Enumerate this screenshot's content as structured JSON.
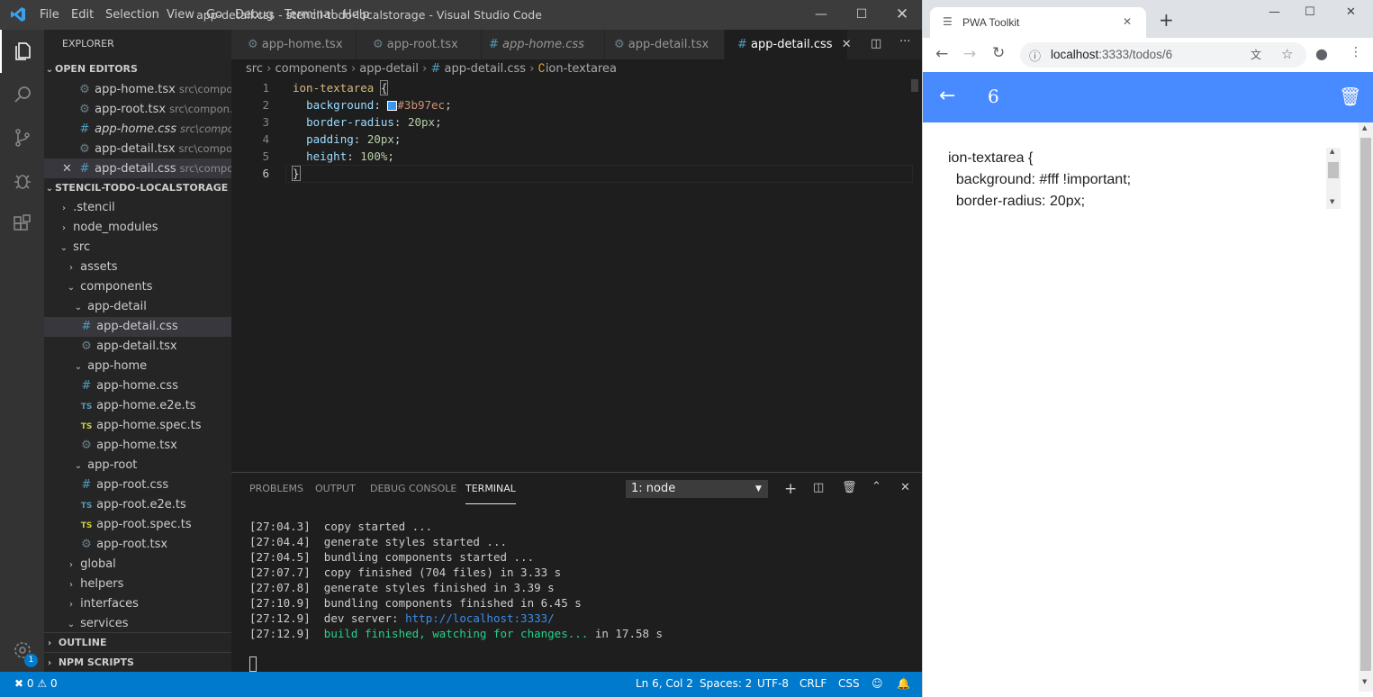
{
  "vscode": {
    "title": "app-detail.css - stencil-todo-localstorage - Visual Studio Code",
    "menu": [
      "File",
      "Edit",
      "Selection",
      "View",
      "Go",
      "Debug",
      "Terminal",
      "Help"
    ],
    "activity_badge": "1",
    "explorer": {
      "title": "EXPLORER",
      "open_editors_header": "OPEN EDITORS",
      "open_editors": [
        {
          "name": "app-home.tsx",
          "path": "src\\compo...",
          "icon": "gear-icon"
        },
        {
          "name": "app-root.tsx",
          "path": "src\\compon...",
          "icon": "gear-icon"
        },
        {
          "name": "app-home.css",
          "path": "src\\compon...",
          "icon": "hash-icon"
        },
        {
          "name": "app-detail.tsx",
          "path": "src\\compo...",
          "icon": "gear-icon"
        },
        {
          "name": "app-detail.css",
          "path": "src\\compo...",
          "icon": "hash-icon"
        }
      ],
      "project_header": "STENCIL-TODO-LOCALSTORAGE",
      "tree": [
        {
          "label": ".stencil",
          "type": "folder"
        },
        {
          "label": "node_modules",
          "type": "folder"
        },
        {
          "label": "src",
          "type": "folder-open"
        },
        {
          "label": "assets",
          "type": "folder"
        },
        {
          "label": "components",
          "type": "folder-open"
        },
        {
          "label": "app-detail",
          "type": "folder-open"
        },
        {
          "label": "app-detail.css",
          "type": "css"
        },
        {
          "label": "app-detail.tsx",
          "type": "tsx"
        },
        {
          "label": "app-home",
          "type": "folder-open"
        },
        {
          "label": "app-home.css",
          "type": "css"
        },
        {
          "label": "app-home.e2e.ts",
          "type": "ts"
        },
        {
          "label": "app-home.spec.ts",
          "type": "ts-spec"
        },
        {
          "label": "app-home.tsx",
          "type": "tsx"
        },
        {
          "label": "app-root",
          "type": "folder-open"
        },
        {
          "label": "app-root.css",
          "type": "css"
        },
        {
          "label": "app-root.e2e.ts",
          "type": "ts"
        },
        {
          "label": "app-root.spec.ts",
          "type": "ts-spec"
        },
        {
          "label": "app-root.tsx",
          "type": "tsx"
        },
        {
          "label": "global",
          "type": "folder"
        },
        {
          "label": "helpers",
          "type": "folder"
        },
        {
          "label": "interfaces",
          "type": "folder"
        },
        {
          "label": "services",
          "type": "folder-open"
        }
      ],
      "outline_header": "OUTLINE",
      "npm_header": "NPM SCRIPTS"
    },
    "tabs": [
      {
        "label": "app-home.tsx",
        "icon": "⚙"
      },
      {
        "label": "app-root.tsx",
        "icon": "⚙"
      },
      {
        "label": "app-home.css",
        "icon": "#"
      },
      {
        "label": "app-detail.tsx",
        "icon": "⚙"
      },
      {
        "label": "app-detail.css",
        "icon": "#"
      }
    ],
    "breadcrumb": [
      "src",
      "components",
      "app-detail",
      "app-detail.css",
      "ion-textarea"
    ],
    "code": {
      "line_numbers": [
        "1",
        "2",
        "3",
        "4",
        "5",
        "6"
      ],
      "selector": "ion-textarea",
      "open_brace": "{",
      "close_brace": "}",
      "props": [
        {
          "name": "background",
          "value": "#3b97ec",
          "swatch": "#3b97ec"
        },
        {
          "name": "border-radius",
          "value": "20px"
        },
        {
          "name": "padding",
          "value": "20px"
        },
        {
          "name": "height",
          "value": "100%"
        }
      ]
    },
    "panel": {
      "tabs": [
        "PROBLEMS",
        "OUTPUT",
        "DEBUG CONSOLE",
        "TERMINAL"
      ],
      "terminal_select": "1: node",
      "lines": [
        {
          "time": "[27:04.3]",
          "text": "copy started ..."
        },
        {
          "time": "[27:04.4]",
          "text": "generate styles started ..."
        },
        {
          "time": "[27:04.5]",
          "text": "bundling components started ..."
        },
        {
          "time": "[27:07.7]",
          "text": "copy finished (704 files) in 3.33 s"
        },
        {
          "time": "[27:07.8]",
          "text": "generate styles finished in 3.39 s"
        },
        {
          "time": "[27:10.9]",
          "text": "bundling components finished in 6.45 s"
        }
      ],
      "dev_server_time": "[27:12.9]",
      "dev_server_label": "dev server:",
      "dev_server_url": "http://localhost:3333/",
      "build_time": "[27:12.9]",
      "build_text": "build finished, watching for changes...",
      "build_suffix": "in 17.58 s"
    },
    "status": {
      "errors": "0",
      "warnings": "0",
      "position": "Ln 6, Col 2",
      "spaces": "Spaces: 2",
      "encoding": "UTF-8",
      "eol": "CRLF",
      "language": "CSS"
    }
  },
  "browser": {
    "tab_title": "PWA Toolkit",
    "url_host": "localhost",
    "url_rest": ":3333/todos/6",
    "page_title": "6",
    "textarea_lines": [
      "ion-textarea {",
      "  background: #fff !important;",
      "  border-radius: 20px;"
    ]
  }
}
